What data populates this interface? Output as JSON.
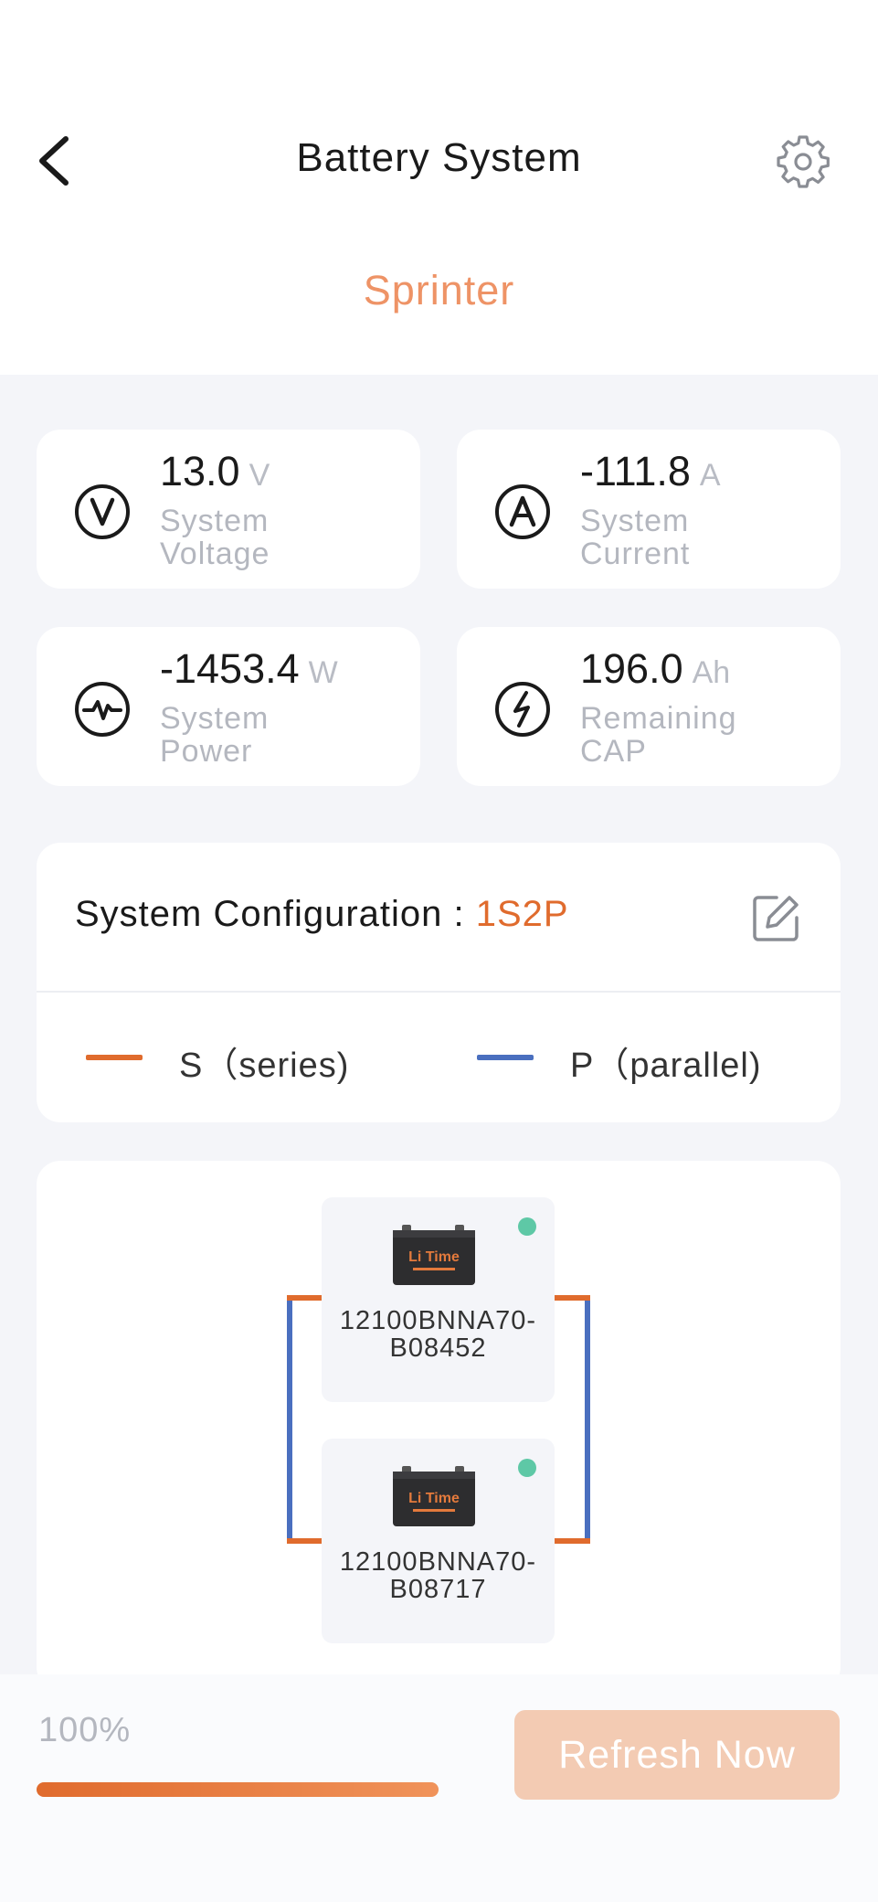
{
  "header": {
    "title": "Battery System",
    "subtitle": "Sprinter"
  },
  "stats": [
    {
      "value": "13.0",
      "unit": "V",
      "label": "System Voltage",
      "icon": "voltage-icon"
    },
    {
      "value": "-111.8",
      "unit": "A",
      "label": "System Current",
      "icon": "current-icon"
    },
    {
      "value": "-1453.4",
      "unit": "W",
      "label": "System Power",
      "icon": "power-icon"
    },
    {
      "value": "196.0",
      "unit": "Ah",
      "label": "Remaining CAP",
      "icon": "capacity-icon"
    }
  ],
  "config": {
    "label": "System Configuration : ",
    "code": "1S2P",
    "legend_series": "S（series)",
    "legend_parallel": "P（parallel)",
    "series_color": "#e06b2d",
    "parallel_color": "#4a6fbf"
  },
  "batteries": [
    {
      "name_line1": "12100BNNA70-",
      "name_line2": "B08452",
      "status_color": "#5ec8a6",
      "logo": "Li Time"
    },
    {
      "name_line1": "12100BNNA70-",
      "name_line2": "B08717",
      "status_color": "#5ec8a6",
      "logo": "Li Time"
    }
  ],
  "footer": {
    "progress_text": "100%",
    "progress": 1.0,
    "refresh_label": "Refresh Now"
  },
  "colors": {
    "accent": "#ee9366",
    "background": "#f4f5f9"
  }
}
